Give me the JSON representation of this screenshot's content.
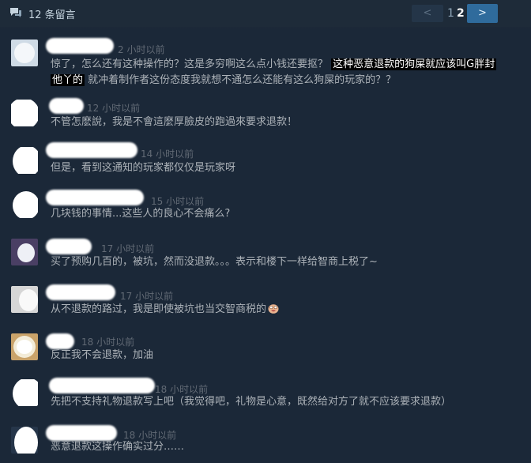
{
  "header": {
    "count_label": "12 条留言",
    "prev_label": "<",
    "page_1": "1",
    "page_2": "2",
    "next_label": ">"
  },
  "comments": [
    {
      "time": "2 小时以前",
      "text_before": "惊了，怎么还有这种操作的？这是多穷啊这么点小钱还要抠？",
      "highlight_1": "这种恶意退款的狗屎就应该叫G胖封",
      "highlight_2": "他丫的",
      "text_after": "就冲着制作者这份态度我就想不通怎么还能有这么狗屎的玩家的？？"
    },
    {
      "time": "12 小时以前",
      "text": "不管怎麽說，我是不會這麼厚臉皮的跑過來要求退款！"
    },
    {
      "time": "14 小时以前",
      "text": "但是，看到这通知的玩家都仅仅是玩家呀"
    },
    {
      "time": "15 小时以前",
      "text": "几块钱的事情...这些人的良心不会痛么?"
    },
    {
      "time": "17 小时以前",
      "text": "买了预购几百的，被坑，然而没退款。。。表示和楼下一样给智商上税了~"
    },
    {
      "time": "17 小时以前",
      "text": "从不退款的路过，我是即使被坑也当交智商税的",
      "emoji": "laughing-face-icon"
    },
    {
      "time": "18 小时以前",
      "text": "反正我不会退款，加油"
    },
    {
      "time": "18 小时以前",
      "text": "先把不支持礼物退款写上吧（我觉得吧，礼物是心意，既然给对方了就不应该要求退款）"
    },
    {
      "time": "18 小时以前",
      "text": "恶意退款这操作确实过分……"
    }
  ],
  "colors": {
    "background": "#1b2838",
    "text": "#acb2b8",
    "timestamp": "#626a75",
    "accent": "#2f6b9c"
  }
}
